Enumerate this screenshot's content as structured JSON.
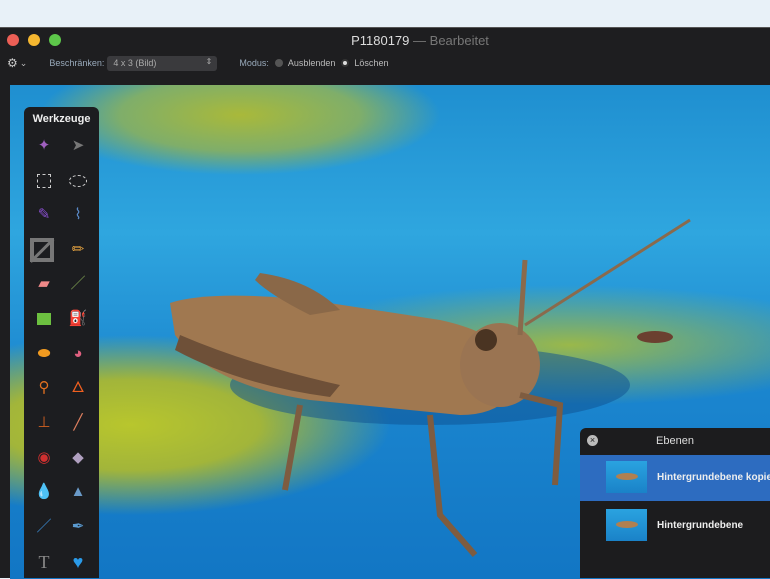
{
  "window": {
    "title": "P1180179",
    "title_separator": "—",
    "status": "Bearbeitet"
  },
  "toolbar": {
    "gear_caret": "⌄",
    "constrain_label": "Beschränken:",
    "constrain_value": "4 x 3 (Bild)",
    "mode_label": "Modus:",
    "mode_options": [
      {
        "label": "Ausblenden",
        "selected": false
      },
      {
        "label": "Löschen",
        "selected": true
      }
    ]
  },
  "tools": {
    "title": "Werkzeuge",
    "items": [
      "magic-wand",
      "arrow-select",
      "rect-select",
      "ellipse-select",
      "paint-select",
      "lasso",
      "crop",
      "pencil",
      "eraser",
      "brush",
      "color-fill",
      "paint-bucket",
      "sponge",
      "smudge",
      "clone-brush",
      "burn",
      "stamp",
      "bandage",
      "red-eye",
      "rubber",
      "blur-drop",
      "sharpen-cone",
      "pen",
      "freeform-pen",
      "text",
      "shape"
    ],
    "text_glyph": "T"
  },
  "layers": {
    "title": "Ebenen",
    "close": "×",
    "items": [
      {
        "name": "Hintergrundebene kopie",
        "selected": true
      },
      {
        "name": "Hintergrundebene",
        "selected": false
      }
    ]
  },
  "colors": {
    "accent": "#2d6cc0",
    "close": "#ec5f56",
    "minimize": "#f5b730",
    "zoom": "#5dc74a"
  }
}
